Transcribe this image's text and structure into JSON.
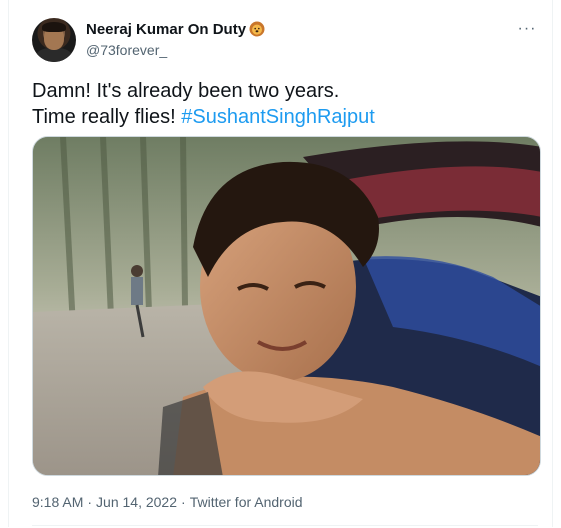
{
  "author": {
    "display_name": "Neeraj Kumar On Duty",
    "badge_icon": "lion-face-icon",
    "handle": "@73forever_"
  },
  "menu": {
    "more_icon": "more-horizontal-icon",
    "more_label": "···"
  },
  "tweet": {
    "line1": "Damn! It's already been two years.",
    "line2_text": "Time really flies! ",
    "hashtag": "#SushantSinghRajput"
  },
  "media": {
    "kind": "photo"
  },
  "meta": {
    "time": "9:18 AM",
    "separator": "·",
    "date": "Jun 14, 2022",
    "source": "Twitter for Android"
  },
  "colors": {
    "link": "#1d9bf0",
    "secondary_text": "#536471",
    "primary_text": "#0f1419"
  }
}
